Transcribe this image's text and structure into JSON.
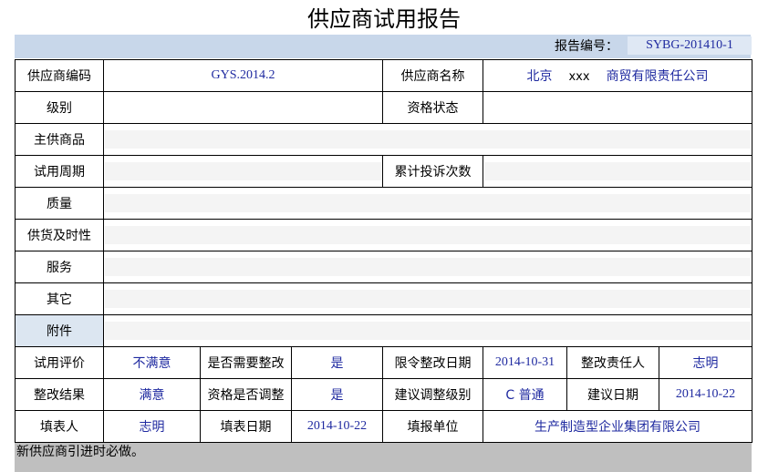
{
  "title": "供应商试用报告",
  "report": {
    "label": "报告编号：",
    "number": "SYBG-201410-1"
  },
  "labels": {
    "supplier_code": "供应商编码",
    "supplier_name": "供应商名称",
    "level": "级别",
    "qualification_status": "资格状态",
    "main_products": "主供商品",
    "trial_period": "试用周期",
    "complaint_count": "累计投诉次数",
    "quality": "质量",
    "delivery": "供货及时性",
    "service": "服务",
    "other": "其它",
    "attachment": "附件",
    "trial_eval": "试用评价",
    "need_rectify": "是否需要整改",
    "rectify_deadline": "限令整改日期",
    "rectify_person": "整改责任人",
    "rectify_result": "整改结果",
    "qual_adjust": "资格是否调整",
    "suggest_level": "建议调整级别",
    "suggest_date": "建议日期",
    "filler": "填表人",
    "fill_date": "填表日期",
    "fill_unit": "填报单位"
  },
  "values": {
    "supplier_code": "GYS.2014.2",
    "supplier_name_city": "北京",
    "supplier_name_mid": "xxx",
    "supplier_name_rest": "商贸有限责任公司",
    "trial_eval": "不满意",
    "need_rectify": "是",
    "rectify_deadline": "2014-10-31",
    "rectify_person": "志明",
    "rectify_result": "满意",
    "qual_adjust": "是",
    "suggest_level": "C 普通",
    "suggest_date": "2014-10-22",
    "filler": "志明",
    "fill_date": "2014-10-22",
    "fill_unit": "生产制造型企业集团有限公司"
  },
  "footer_note": "新供应商引进时必做。"
}
